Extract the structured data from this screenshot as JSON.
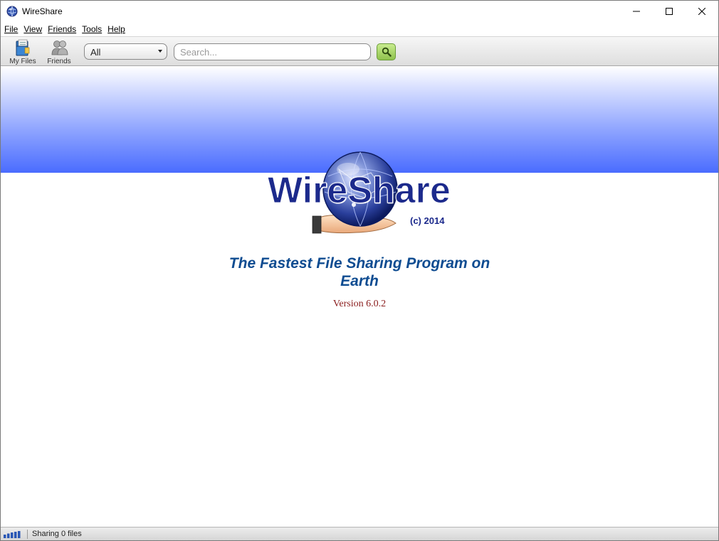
{
  "window": {
    "title": "WireShare"
  },
  "menu": {
    "items": [
      "File",
      "View",
      "Friends",
      "Tools",
      "Help"
    ]
  },
  "toolbar": {
    "my_files_label": "My Files",
    "friends_label": "Friends",
    "category_value": "All",
    "search_placeholder": "Search..."
  },
  "splash": {
    "logo_text": "WireShare",
    "copyright": "(c) 2014",
    "tagline": "The Fastest File Sharing Program on Earth",
    "version": "Version 6.0.2"
  },
  "status": {
    "sharing_text": "Sharing 0 files"
  },
  "colors": {
    "banner_bottom": "#4a6cff",
    "logo_text": "#1c2a8c",
    "tagline": "#0f4c91",
    "version": "#8a1c1c",
    "search_button": "#8fc24d"
  },
  "icons": {
    "app": "globe-icon",
    "my_files": "folder-files-icon",
    "friends": "friends-icon",
    "search": "magnifier-icon",
    "connection": "signal-bars-icon"
  }
}
